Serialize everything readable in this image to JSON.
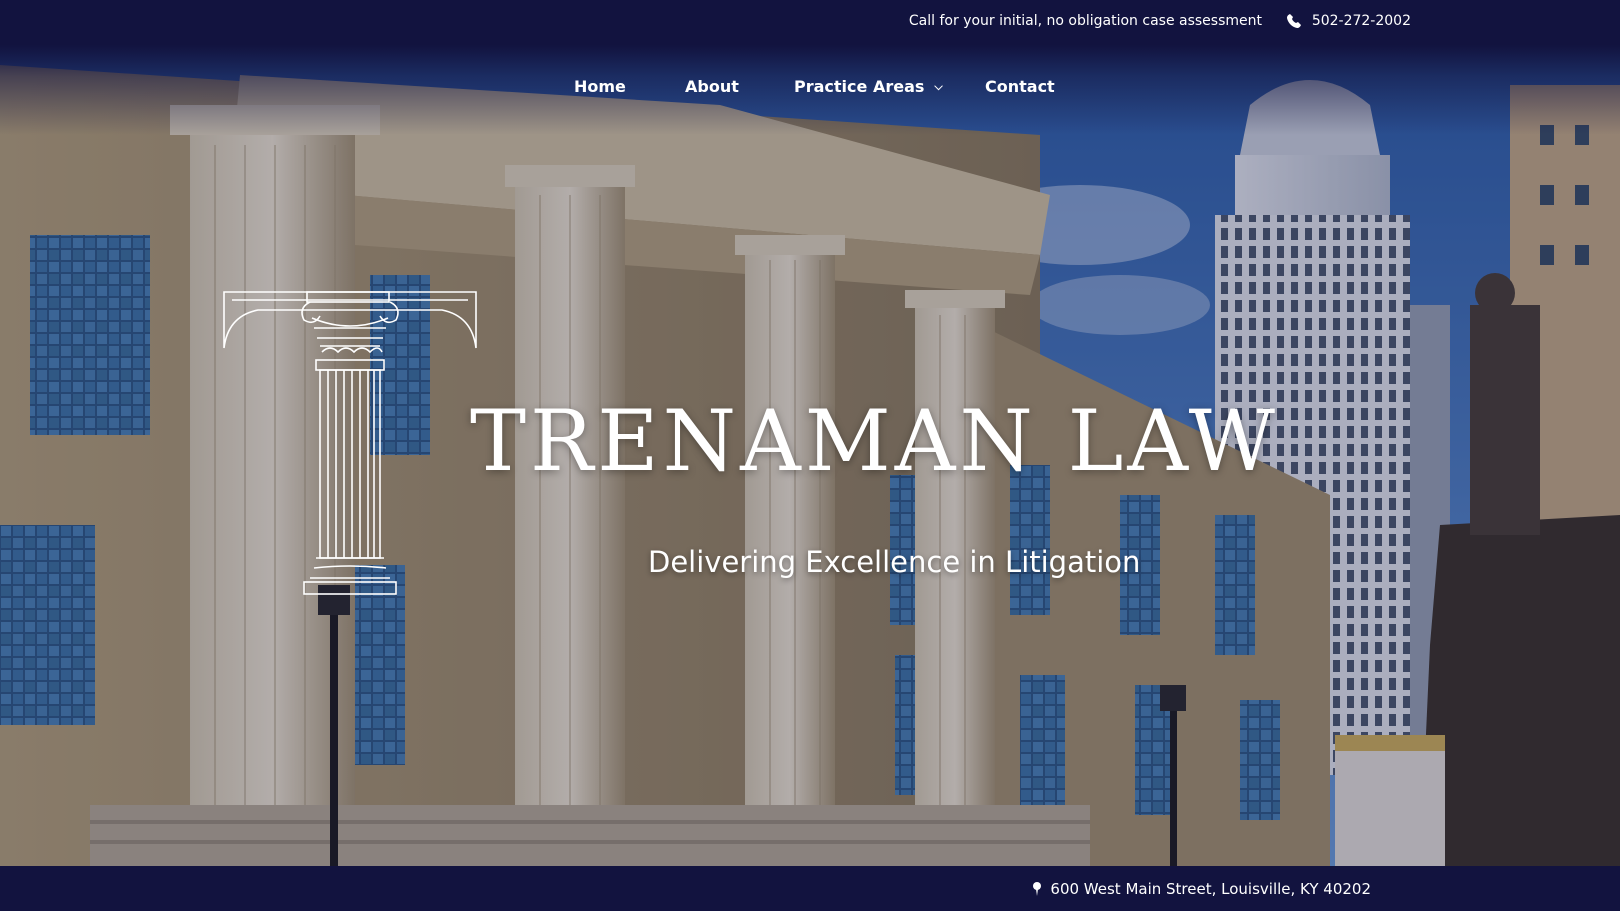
{
  "topbar": {
    "cta_text": "Call for your initial, no obligation case assessment",
    "phone": "502-272-2002",
    "phone_icon": "phone-icon"
  },
  "nav": {
    "items": [
      {
        "label": "Home"
      },
      {
        "label": "About"
      },
      {
        "label": "Practice Areas",
        "has_dropdown": true
      },
      {
        "label": "Contact"
      }
    ],
    "dropdown_icon": "chevron-down-icon"
  },
  "hero": {
    "brand": "TRENAMAN LAW",
    "tagline": "Delivering Excellence in Litigation",
    "logo_icon": "column-capital-icon"
  },
  "footer": {
    "address": "600 West Main Street, Louisville, KY 40202",
    "address_icon": "map-pin-icon"
  },
  "colors": {
    "navy": "#12133f",
    "text": "#ffffff",
    "sky": "#3d78c7",
    "stone": "#c9b891"
  }
}
